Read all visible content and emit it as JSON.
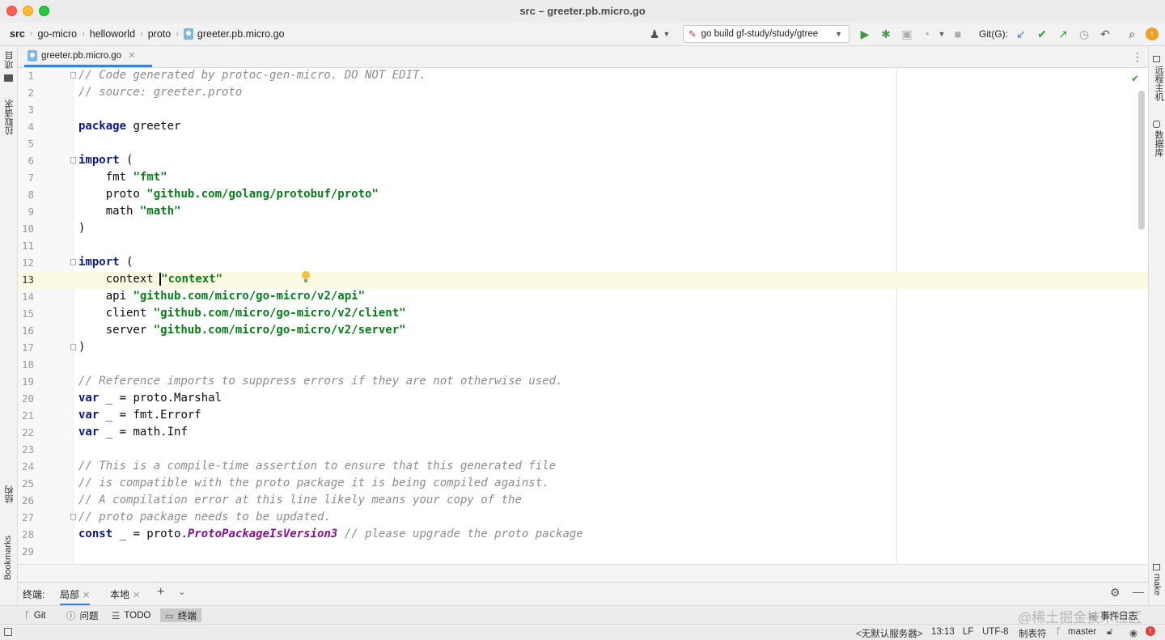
{
  "window": {
    "title": "src – greeter.pb.micro.go"
  },
  "breadcrumbs": [
    "src",
    "go-micro",
    "helloworld",
    "proto",
    "greeter.pb.micro.go"
  ],
  "toolbar": {
    "run_config": "go build gf-study/study/gtree",
    "git_label": "Git(G):"
  },
  "left_strip": {
    "project": "项目",
    "pull_requests": "拉取请求",
    "structure": "结构",
    "bookmarks": "Bookmarks"
  },
  "right_strip": {
    "remote_host": "远程主机",
    "database": "数据库",
    "make": "make"
  },
  "editor_tab": {
    "label": "greeter.pb.micro.go"
  },
  "code_lines": [
    [
      [
        "cmt",
        "// Code generated by protoc-gen-micro. DO NOT EDIT."
      ]
    ],
    [
      [
        "cmt",
        "// source: greeter.proto"
      ]
    ],
    [],
    [
      [
        "kw",
        "package"
      ],
      [
        "txt",
        " greeter"
      ]
    ],
    [],
    [
      [
        "kw",
        "import"
      ],
      [
        "txt",
        " ("
      ]
    ],
    [
      [
        "txt",
        "    fmt "
      ],
      [
        "str",
        "\"fmt\""
      ]
    ],
    [
      [
        "txt",
        "    proto "
      ],
      [
        "str",
        "\"github.com/golang/protobuf/proto\""
      ]
    ],
    [
      [
        "txt",
        "    math "
      ],
      [
        "str",
        "\"math\""
      ]
    ],
    [
      [
        "txt",
        ")"
      ]
    ],
    [],
    [
      [
        "kw",
        "import"
      ],
      [
        "txt",
        " ("
      ]
    ],
    [
      [
        "txt",
        "    context "
      ],
      [
        "caret",
        ""
      ],
      [
        "str",
        "\"context\""
      ]
    ],
    [
      [
        "txt",
        "    api "
      ],
      [
        "str",
        "\"github.com/micro/go-micro/v2/api\""
      ]
    ],
    [
      [
        "txt",
        "    client "
      ],
      [
        "str",
        "\"github.com/micro/go-micro/v2/client\""
      ]
    ],
    [
      [
        "txt",
        "    server "
      ],
      [
        "str",
        "\"github.com/micro/go-micro/v2/server\""
      ]
    ],
    [
      [
        "txt",
        ")"
      ]
    ],
    [],
    [
      [
        "cmt",
        "// Reference imports to suppress errors if they are not otherwise used."
      ]
    ],
    [
      [
        "kw",
        "var"
      ],
      [
        "txt",
        " _ = proto.Marshal"
      ]
    ],
    [
      [
        "kw",
        "var"
      ],
      [
        "txt",
        " _ = fmt.Errorf"
      ]
    ],
    [
      [
        "kw",
        "var"
      ],
      [
        "txt",
        " _ = math.Inf"
      ]
    ],
    [],
    [
      [
        "cmt",
        "// This is a compile-time assertion to ensure that this generated file"
      ]
    ],
    [
      [
        "cmt",
        "// is compatible with the proto package it is being compiled against."
      ]
    ],
    [
      [
        "cmt",
        "// A compilation error at this line likely means your copy of the"
      ]
    ],
    [
      [
        "cmt",
        "// proto package needs to be updated."
      ]
    ],
    [
      [
        "kw",
        "const"
      ],
      [
        "txt",
        " _ = proto."
      ],
      [
        "cst",
        "ProtoPackageIsVersion3"
      ],
      [
        "txt",
        " "
      ],
      [
        "cmt",
        "// please upgrade the proto package"
      ]
    ],
    []
  ],
  "current_line": 13,
  "fold_lines": [
    1,
    6,
    12,
    17,
    27
  ],
  "terminal": {
    "label": "终端:",
    "tabs": [
      "局部",
      "本地"
    ]
  },
  "tool_windows": [
    "Git",
    "问题",
    "TODO",
    "终端"
  ],
  "active_tool_window": "终端",
  "event_log": "事件日志",
  "status": {
    "server": "<无默认服务器>",
    "position": "13:13",
    "line_sep": "LF",
    "encoding": "UTF-8",
    "indent": "制表符",
    "branch": "master"
  },
  "watermark": "@稀土掘金技术社区",
  "colors": {
    "keyword": "#0b1a8a",
    "string": "#067d17",
    "comment": "#8c8c8c",
    "constant": "#871094",
    "tab_accent": "#3d7fdb"
  }
}
